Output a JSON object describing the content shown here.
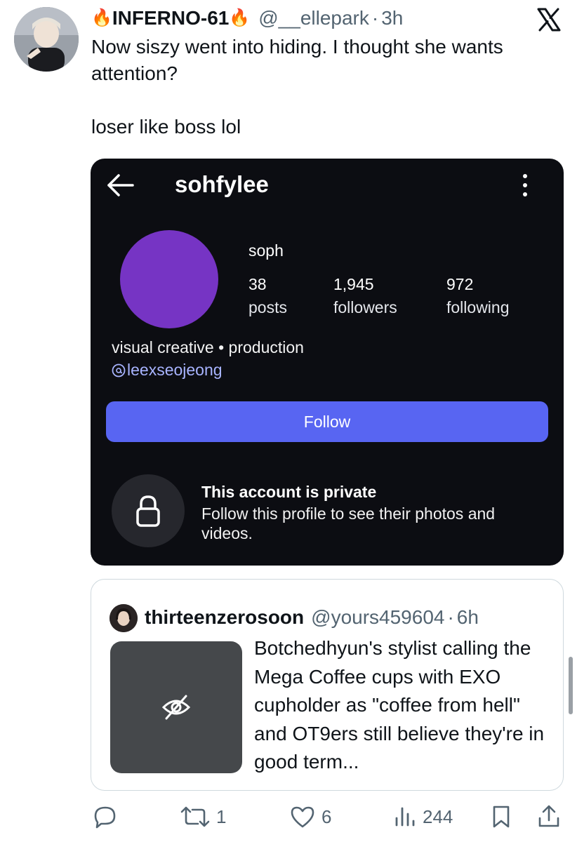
{
  "tweet": {
    "display_name": "INFERNO-61",
    "name_emoji": "🔥",
    "handle": "@__ellepark",
    "separator": "·",
    "time": "3h",
    "text": "Now siszy went into hiding. I thought she wants attention?\n\nloser like boss lol"
  },
  "instagram": {
    "username": "sohfylee",
    "name": "soph",
    "stats": [
      {
        "value": "38",
        "label": "posts"
      },
      {
        "value": "1,945",
        "label": "followers"
      },
      {
        "value": "972",
        "label": "following"
      }
    ],
    "bio": "visual creative • production",
    "threads_handle": "leexseojeong",
    "follow_button": "Follow",
    "private_title": "This account is private",
    "private_desc": "Follow this profile to see their photos and videos.",
    "avatar_color": "#7634c4",
    "follow_color": "#5865f2"
  },
  "quote": {
    "display_name": "thirteenzerosoon",
    "handle": "@yours459604",
    "separator": "·",
    "time": "6h",
    "text": "Botchedhyun's stylist calling the Mega Coffee cups with EXO cupholder as \"coffee from hell\" and OT9ers still believe they're in good term..."
  },
  "actions": {
    "reply": "",
    "retweets": "1",
    "likes": "6",
    "views": "244"
  },
  "icons": [
    "x-logo-icon",
    "back-arrow-icon",
    "more-vert-icon",
    "threads-icon",
    "lock-icon",
    "eye-off-icon",
    "reply-icon",
    "retweet-icon",
    "like-icon",
    "views-icon",
    "bookmark-icon",
    "share-icon"
  ]
}
